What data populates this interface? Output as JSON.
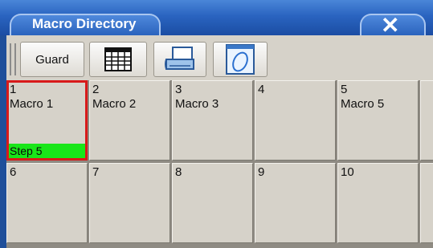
{
  "window": {
    "title": "Macro Directory",
    "close_glyph": "✕",
    "accent": "#2a64c0"
  },
  "toolbar": {
    "guard_label": "Guard",
    "icons": [
      "grid-view-icon",
      "printer-icon",
      "edit-shape-icon"
    ]
  },
  "macros": {
    "cells": [
      {
        "number": "1",
        "name": "Macro 1",
        "status": "Step 5",
        "selected": true
      },
      {
        "number": "2",
        "name": "Macro 2"
      },
      {
        "number": "3",
        "name": "Macro 3"
      },
      {
        "number": "4",
        "name": ""
      },
      {
        "number": "5",
        "name": "Macro 5"
      },
      {
        "number": "6",
        "name": ""
      },
      {
        "number": "7",
        "name": ""
      },
      {
        "number": "8",
        "name": ""
      },
      {
        "number": "9",
        "name": ""
      },
      {
        "number": "10",
        "name": ""
      }
    ],
    "status_color": "#19e619",
    "selected_color": "#d81a1a"
  }
}
